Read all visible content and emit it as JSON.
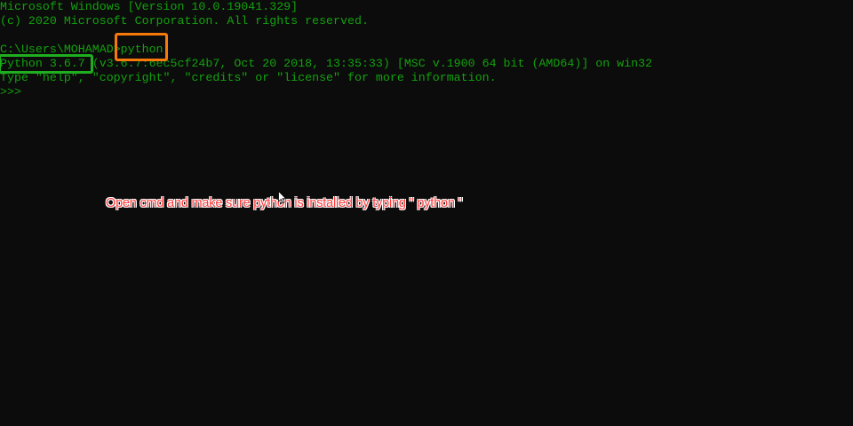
{
  "terminal": {
    "lines": [
      "Microsoft Windows [Version 10.0.19041.329]",
      "(c) 2020 Microsoft Corporation. All rights reserved.",
      "",
      "C:\\Users\\MOHAMAD>python",
      "Python 3.6.7 (v3.6.7:6ec5cf24b7, Oct 20 2018, 13:35:33) [MSC v.1900 64 bit (AMD64)] on win32",
      "Type \"help\", \"copyright\", \"credits\" or \"license\" for more information.",
      ">>>"
    ]
  },
  "annotation": {
    "caption": "Open cmd and make sure python is installed by typing \" python \""
  },
  "colors": {
    "background": "#0c0c0c",
    "text": "#13a10e",
    "highlight_command": "#f7790a",
    "highlight_version": "#1fae1f",
    "caption": "#ff3b3b"
  },
  "icons": {
    "cursor": "mouse-pointer-icon"
  }
}
